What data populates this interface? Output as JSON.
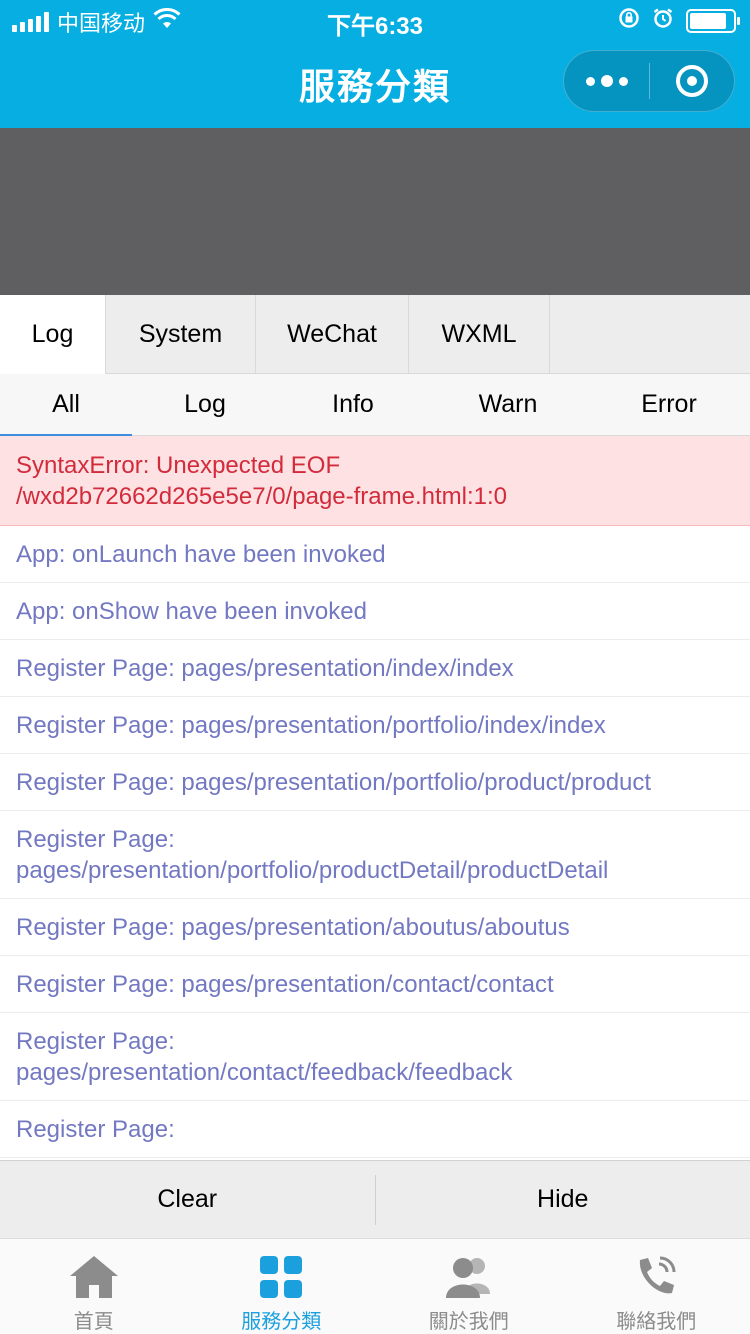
{
  "status_bar": {
    "carrier": "中国移动",
    "time": "下午6:33",
    "battery_level": 0.85
  },
  "nav": {
    "title": "服務分類"
  },
  "console": {
    "tabs": [
      {
        "label": "Log",
        "active": true
      },
      {
        "label": "System",
        "active": false
      },
      {
        "label": "WeChat",
        "active": false
      },
      {
        "label": "WXML",
        "active": false
      }
    ],
    "filters": [
      {
        "label": "All",
        "active": true
      },
      {
        "label": "Log",
        "active": false
      },
      {
        "label": "Info",
        "active": false
      },
      {
        "label": "Warn",
        "active": false
      },
      {
        "label": "Error",
        "active": false
      }
    ],
    "logs": [
      {
        "level": "error",
        "text": "SyntaxError: Unexpected EOF\n/wxd2b72662d265e5e7/0/page-frame.html:1:0"
      },
      {
        "level": "log",
        "text": "App: onLaunch have been invoked"
      },
      {
        "level": "log",
        "text": "App: onShow have been invoked"
      },
      {
        "level": "log",
        "text": "Register Page: pages/presentation/index/index"
      },
      {
        "level": "log",
        "text": "Register Page: pages/presentation/portfolio/index/index"
      },
      {
        "level": "log",
        "text": "Register Page: pages/presentation/portfolio/product/product"
      },
      {
        "level": "log",
        "text": "Register Page:\npages/presentation/portfolio/productDetail/productDetail"
      },
      {
        "level": "log",
        "text": "Register Page: pages/presentation/aboutus/aboutus"
      },
      {
        "level": "log",
        "text": "Register Page: pages/presentation/contact/contact"
      },
      {
        "level": "log",
        "text": "Register Page:\npages/presentation/contact/feedback/feedback"
      },
      {
        "level": "log",
        "text": "Register Page:"
      }
    ],
    "actions": {
      "clear_label": "Clear",
      "hide_label": "Hide"
    }
  },
  "tabbar": {
    "items": [
      {
        "label": "首頁",
        "icon": "home-icon",
        "active": false
      },
      {
        "label": "服務分類",
        "icon": "grid-icon",
        "active": true
      },
      {
        "label": "關於我們",
        "icon": "users-icon",
        "active": false
      },
      {
        "label": "聯絡我們",
        "icon": "phone-icon",
        "active": false
      }
    ]
  },
  "colors": {
    "brand": "#06aee2",
    "error_bg": "#fee1e2",
    "error_text": "#d22b3c",
    "log_text": "#7378c2",
    "tab_active": "#1ba0dd",
    "tab_inactive": "#8c8c8c"
  }
}
